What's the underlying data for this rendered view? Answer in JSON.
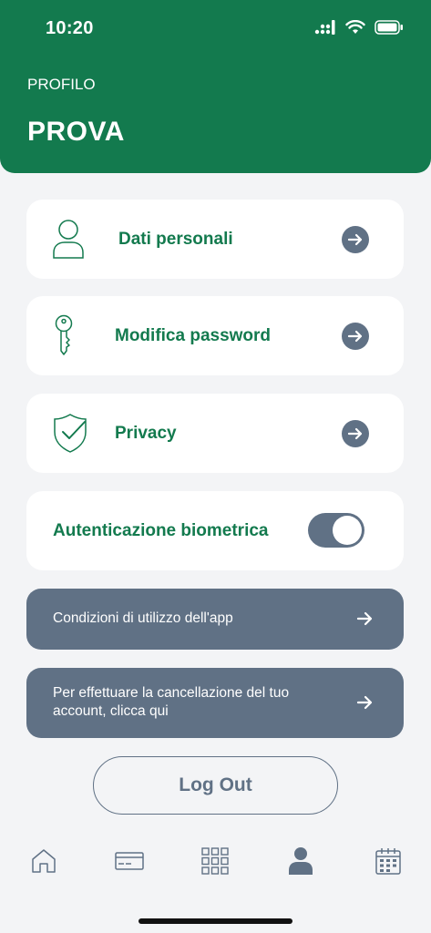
{
  "status_bar": {
    "time": "10:20"
  },
  "header": {
    "label": "PROFILO",
    "title": "PROVA"
  },
  "menu": {
    "personal_data": {
      "label": "Dati personali",
      "icon": "user-icon"
    },
    "change_password": {
      "label": "Modifica password",
      "icon": "key-icon"
    },
    "privacy": {
      "label": "Privacy",
      "icon": "shield-check-icon"
    },
    "biometric": {
      "label": "Autenticazione biometrica",
      "enabled": true
    }
  },
  "links": {
    "terms": {
      "label": "Condizioni di utilizzo dell'app"
    },
    "delete_account": {
      "line1": "Per effettuare la cancellazione del tuo",
      "line2": "account, clicca qui"
    }
  },
  "logout": {
    "label": "Log Out"
  },
  "tabbar": [
    "home-icon",
    "card-icon",
    "grid-icon",
    "profile-icon",
    "calendar-icon"
  ],
  "colors": {
    "primary": "#137a4e",
    "slate": "#607185",
    "background": "#f3f4f6"
  }
}
